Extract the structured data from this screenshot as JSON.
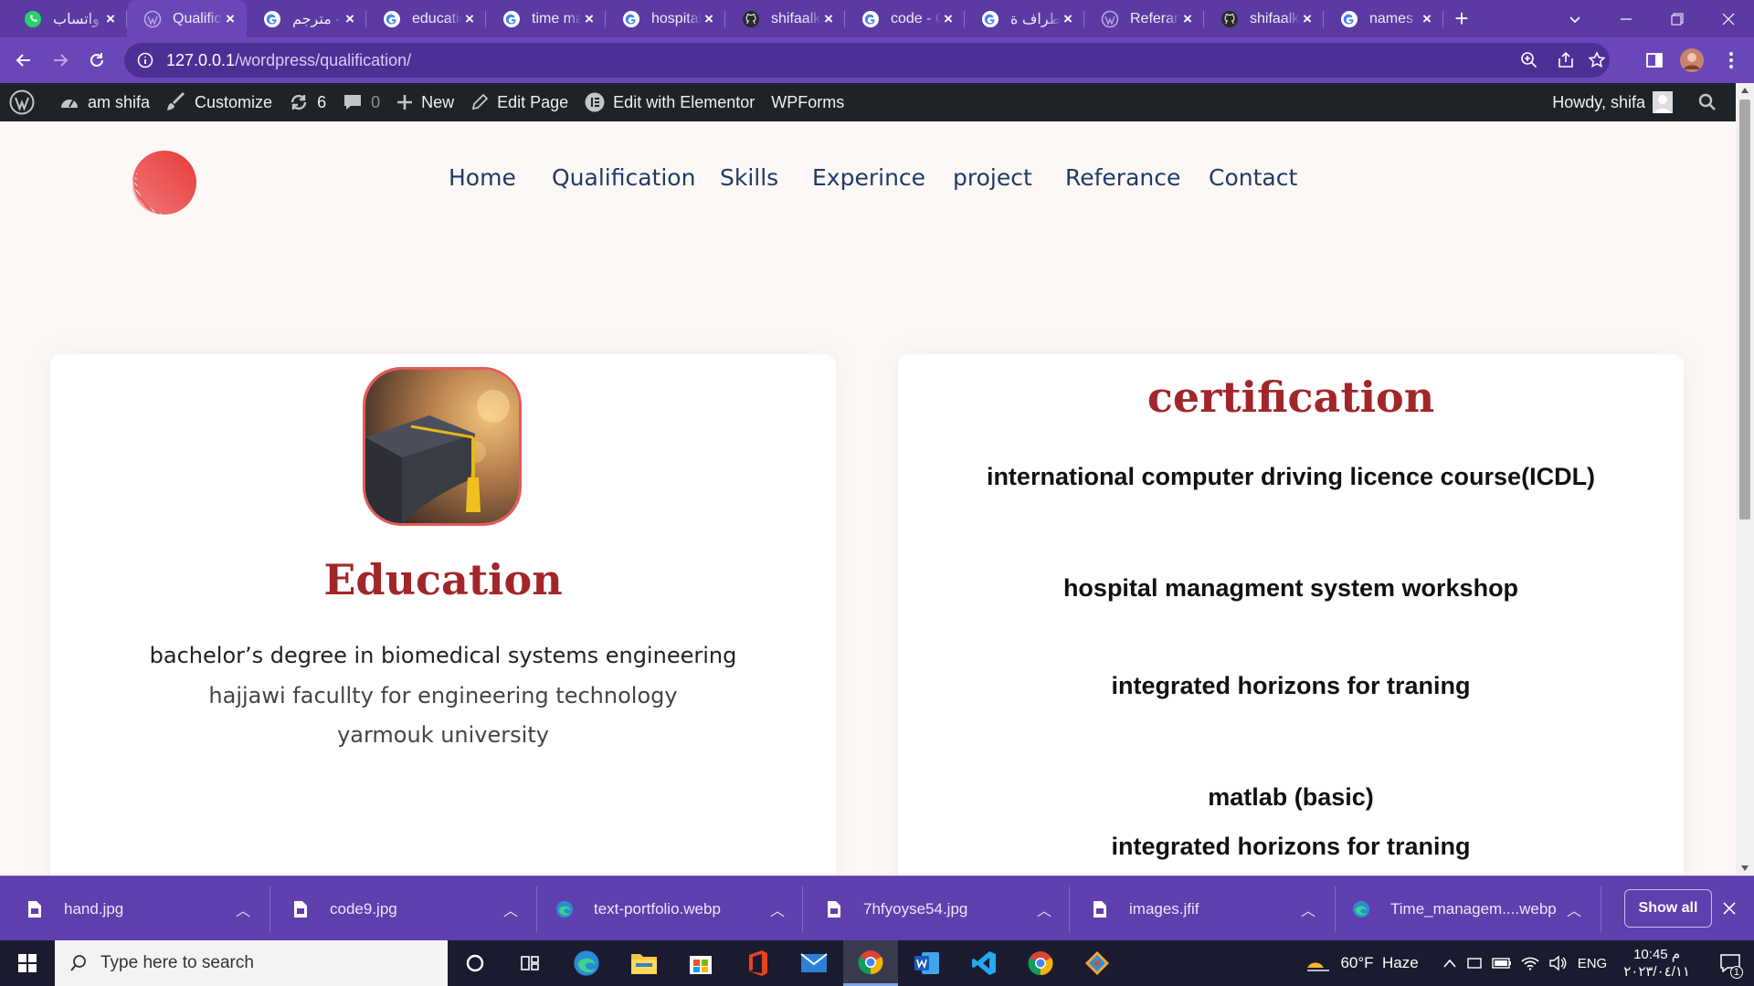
{
  "browser": {
    "tabs": [
      {
        "title": "واتساب",
        "icon": "whatsapp-icon",
        "active": false
      },
      {
        "title": "Qualification",
        "icon": "wordpress-icon",
        "active": true
      },
      {
        "title": "مترجم -",
        "icon": "google-icon",
        "active": false
      },
      {
        "title": "education",
        "icon": "google-icon",
        "active": false
      },
      {
        "title": "time ma",
        "icon": "google-icon",
        "active": false
      },
      {
        "title": "hospital",
        "icon": "google-icon",
        "active": false
      },
      {
        "title": "shifaalk",
        "icon": "github-icon",
        "active": false
      },
      {
        "title": "code - G",
        "icon": "google-icon",
        "active": false
      },
      {
        "title": "اطراف ة",
        "icon": "google-icon",
        "active": false
      },
      {
        "title": "Referan",
        "icon": "wordpress-icon",
        "active": false
      },
      {
        "title": "shifaalk",
        "icon": "github-icon",
        "active": false
      },
      {
        "title": "names",
        "icon": "google-icon",
        "active": false
      }
    ],
    "new_tab_label": "+",
    "url_host": "127.0.0.1",
    "url_path": "/wordpress/qualification/"
  },
  "wp_admin_bar": {
    "site_name": "am shifa",
    "customize": "Customize",
    "updates_count": "6",
    "comments_count": "0",
    "new_label": "New",
    "edit_page": "Edit Page",
    "edit_elementor": "Edit with Elementor",
    "wpforms": "WPForms",
    "howdy": "Howdy, shifa"
  },
  "site_nav": {
    "items": [
      "Home",
      "Qualification",
      "Skills",
      "Experince",
      "project",
      "Referance",
      "Contact"
    ]
  },
  "education": {
    "title": "Education",
    "degree": "bachelor’s degree in biomedical systems engineering",
    "faculty": "hajjawi facullty for engineering technology",
    "university": "yarmouk university"
  },
  "certification": {
    "title": "certification",
    "items": [
      "international computer driving licence course(ICDL)",
      "hospital managment system workshop",
      "integrated horizons for traning",
      "matlab (basic)",
      "integrated horizons for traning"
    ]
  },
  "downloads": {
    "files": [
      {
        "name": "hand.jpg",
        "icon": "file-icon"
      },
      {
        "name": "code9.jpg",
        "icon": "file-icon"
      },
      {
        "name": "text-portfolio.webp",
        "icon": "edge-icon"
      },
      {
        "name": "7hfyoyse54.jpg",
        "icon": "file-icon"
      },
      {
        "name": "images.jfif",
        "icon": "file-icon"
      },
      {
        "name": "Time_managem....webp",
        "icon": "edge-icon"
      }
    ],
    "show_all": "Show all"
  },
  "taskbar": {
    "search_placeholder": "Type here to search",
    "weather": "60°F  Haze",
    "language": "ENG",
    "time": "10:45 م",
    "date": "٢٠٢٣/٠٤/١١",
    "notification_count": "1"
  },
  "colors": {
    "browser_purple": "#5b3aa3",
    "wp_bar": "#1d2327",
    "heading_red": "#a1262a",
    "nav_blue": "#1f3a66",
    "page_bg": "#fdf8f6"
  }
}
